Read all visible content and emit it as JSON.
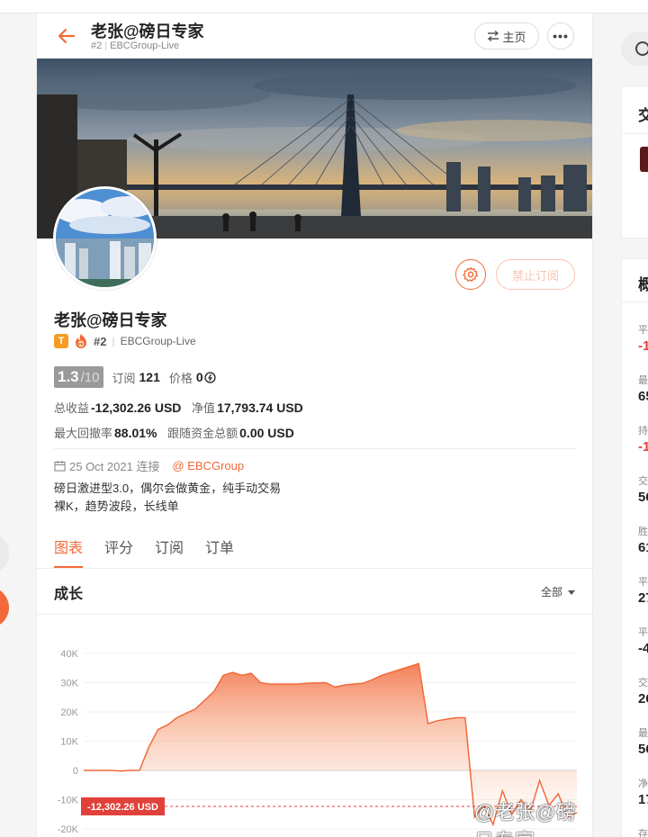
{
  "header": {
    "title": "老张@磅日专家",
    "rank": "#2",
    "broker": "EBCGroup-Live",
    "home_label": "主页",
    "more_label": "•••"
  },
  "profile": {
    "name": "老张@磅日专家",
    "badge_t": "T",
    "badge_fire": "PK",
    "rank": "#2",
    "broker": "EBCGroup-Live",
    "rating": "1.3",
    "rating_max": "/10",
    "subscribe_label": "订阅",
    "subscribe_count": "121",
    "price_label": "价格",
    "price_value": "0",
    "ban_button": "禁止订阅",
    "total_profit_label": "总收益",
    "total_profit_value": "-12,302.26 USD",
    "net_value_label": "净值",
    "net_value_value": "17,793.74 USD",
    "max_drawdown_label": "最大回撤率",
    "max_drawdown_value": "88.01%",
    "follow_total_label": "跟随资金总额",
    "follow_total_value": "0.00 USD",
    "joined": "25 Oct 2021 连接",
    "joined_org": "@ EBCGroup",
    "bio_line1": "磅日激进型3.0，偶尔会做黄金，纯手动交易",
    "bio_line2": "裸K，趋势波段，长线单"
  },
  "tabs": [
    {
      "label": "图表",
      "active": true
    },
    {
      "label": "评分",
      "active": false
    },
    {
      "label": "订阅",
      "active": false
    },
    {
      "label": "订单",
      "active": false
    }
  ],
  "growth": {
    "title": "成长",
    "range_label": "全部"
  },
  "chart_data": {
    "type": "area",
    "title": "",
    "xlabel": "",
    "ylabel": "",
    "ylim": [
      -20000,
      40000
    ],
    "yticks": [
      "40K",
      "30K",
      "20K",
      "10K",
      "0",
      "-10K",
      "-20K"
    ],
    "ytick_values": [
      40000,
      30000,
      20000,
      10000,
      0,
      -10000,
      -20000
    ],
    "current_label": "-12,302.26 USD",
    "current_value": -12302.26,
    "accent": "#f26a3b",
    "values": [
      0,
      0,
      0,
      0,
      -200,
      0,
      0,
      8000,
      14000,
      15500,
      18000,
      19500,
      21000,
      24000,
      27000,
      32500,
      33500,
      32500,
      33200,
      30000,
      29500,
      29500,
      29500,
      29500,
      29800,
      29900,
      30000,
      28500,
      29200,
      29500,
      29800,
      31000,
      32500,
      33500,
      34500,
      35500,
      36500,
      16000,
      17000,
      17500,
      18000,
      18000,
      -16000,
      -12000,
      -18500,
      -7000,
      -15000,
      -10000,
      -14000,
      -3500,
      -12000,
      -8000,
      -16000,
      -14500
    ]
  },
  "watermark": "@老张@磅日专家",
  "right_panel": {
    "card1_title": "交",
    "card2_title": "概",
    "rows": [
      {
        "label": "平",
        "value": "-1",
        "neg": true
      },
      {
        "label": "最",
        "value": "65",
        "neg": false
      },
      {
        "label": "持",
        "value": "-1",
        "neg": true
      },
      {
        "label": "交",
        "value": "56",
        "neg": false
      },
      {
        "label": "胜",
        "value": "61",
        "neg": false
      },
      {
        "label": "平",
        "value": "27",
        "neg": false
      },
      {
        "label": "平",
        "value": "-4",
        "neg": false
      },
      {
        "label": "交",
        "value": "26",
        "neg": false
      },
      {
        "label": "最",
        "value": "56",
        "neg": false
      },
      {
        "label": "净",
        "value": "17",
        "neg": false
      },
      {
        "label": "存",
        "value": "",
        "neg": false
      }
    ]
  }
}
